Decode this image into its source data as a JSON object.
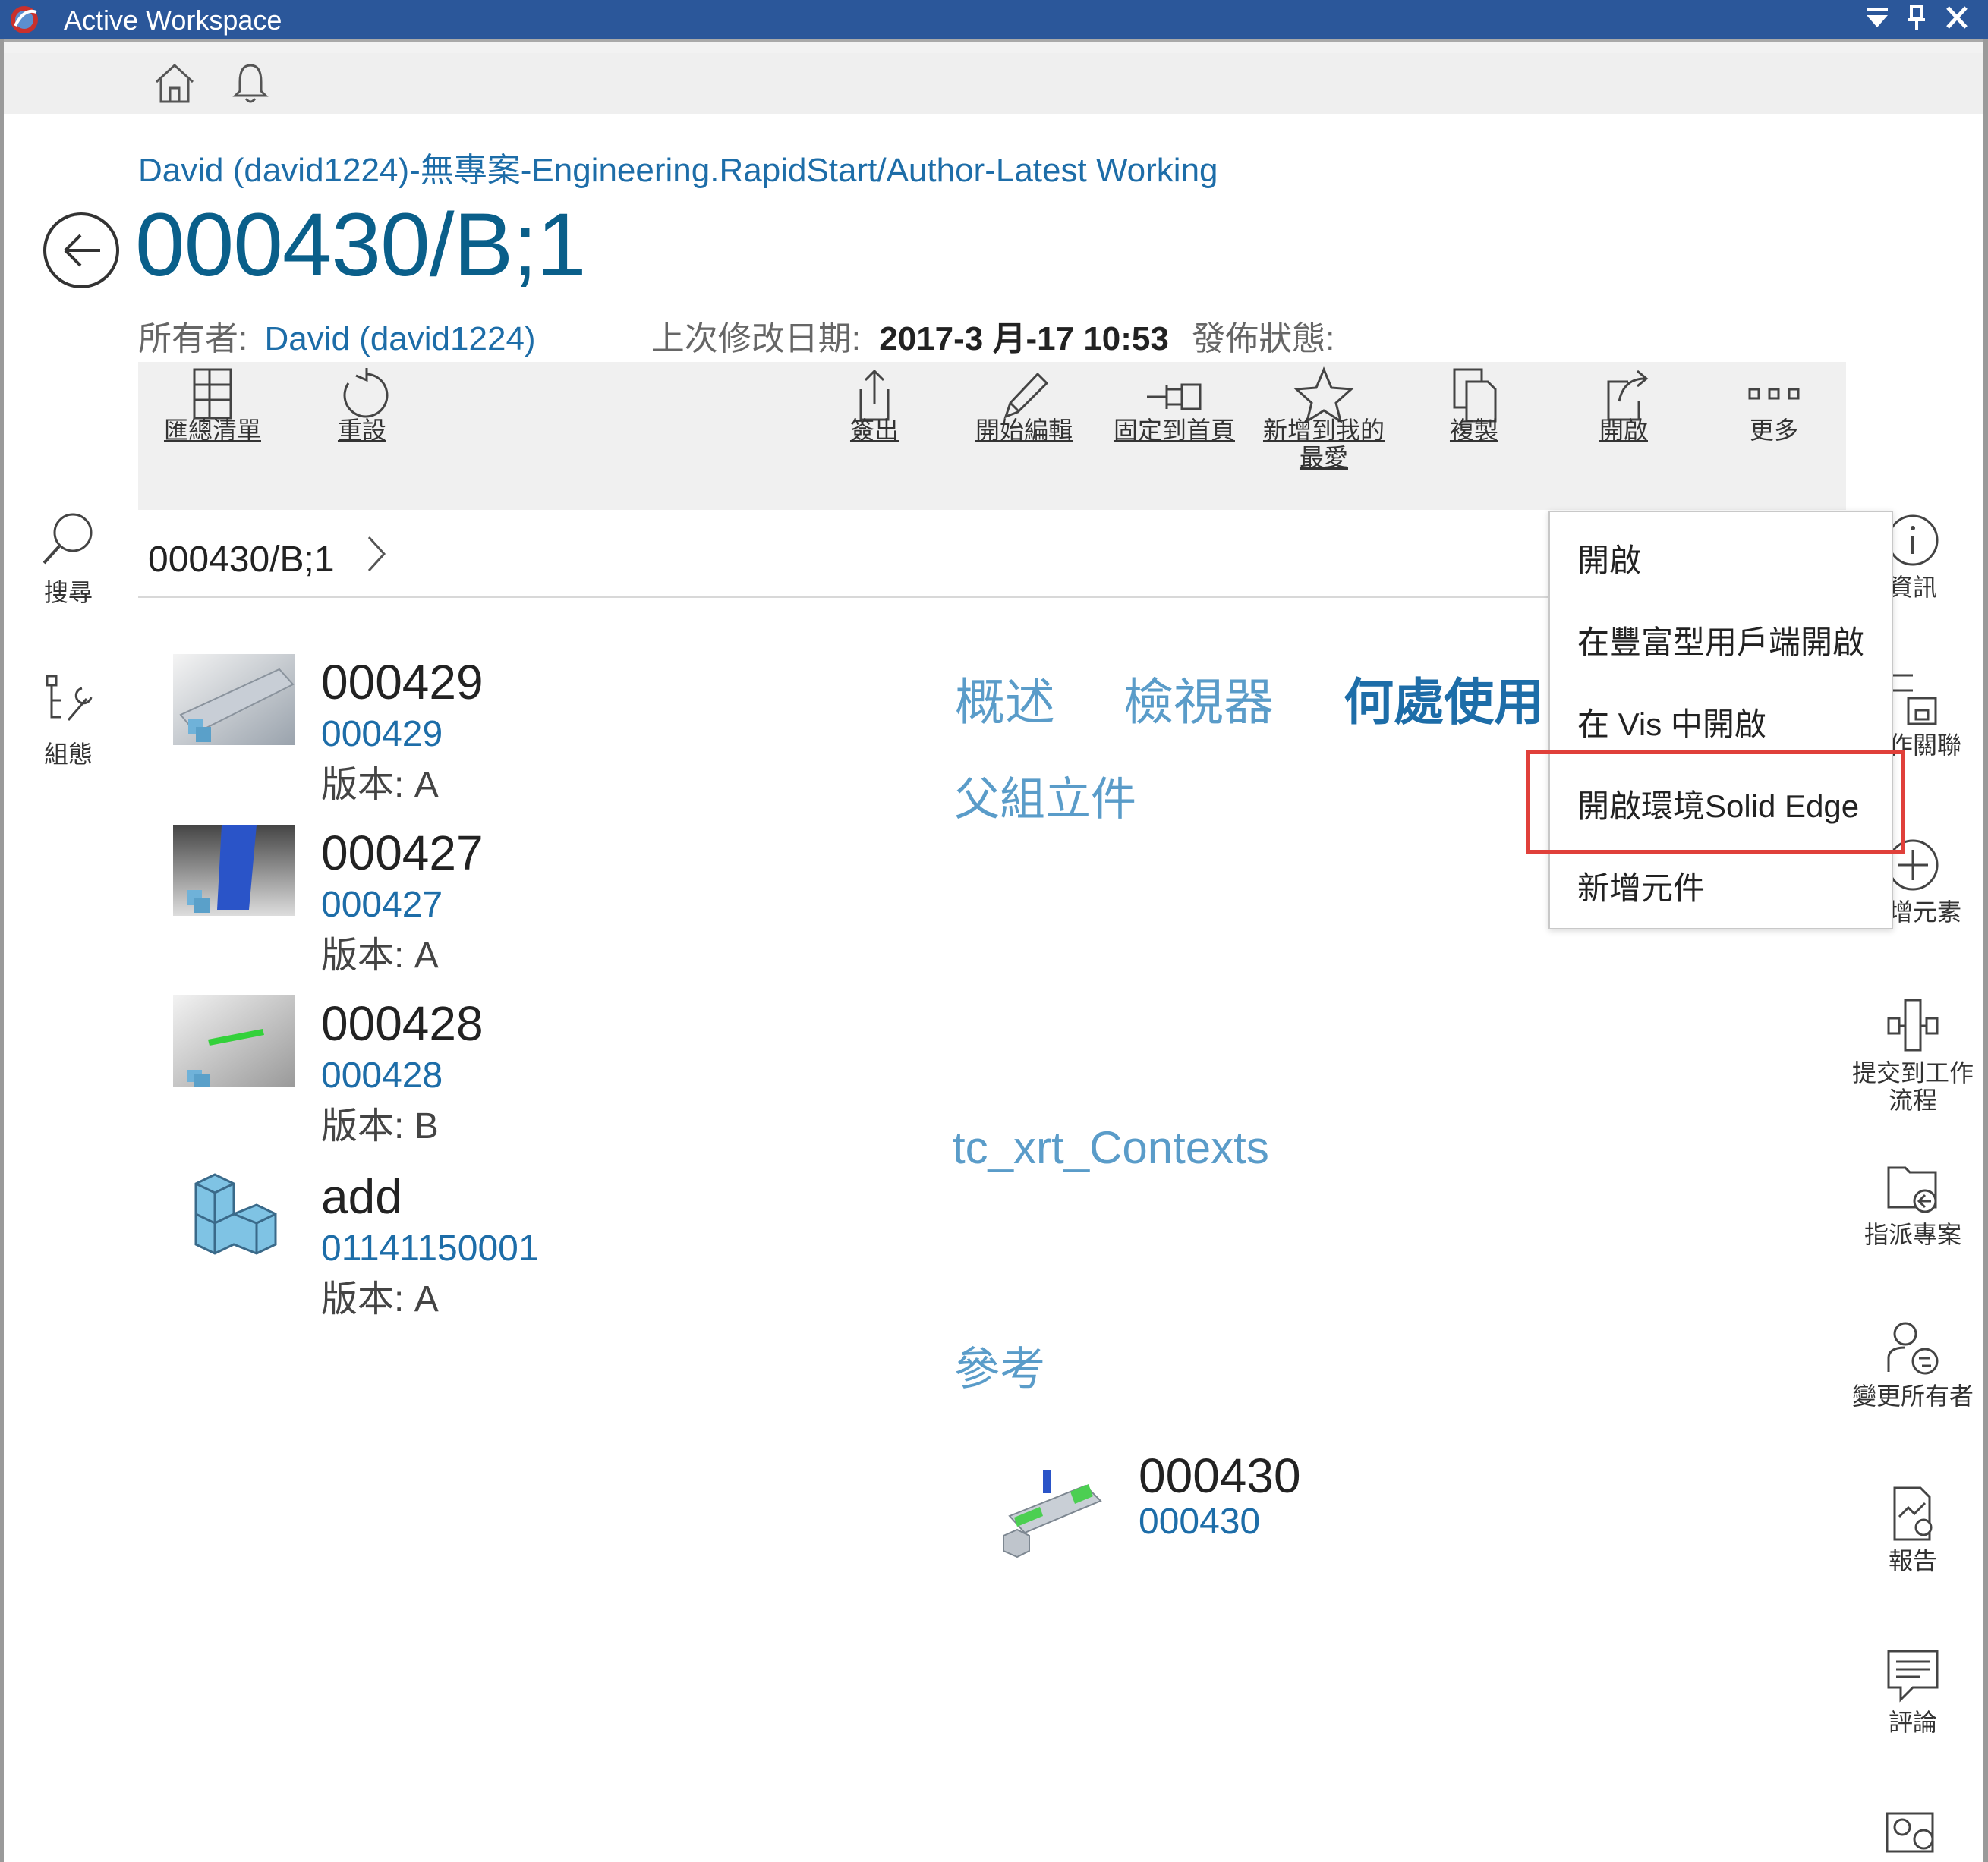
{
  "window": {
    "title": "Active Workspace",
    "controls": [
      "dropdown-icon",
      "pin-icon",
      "close-icon"
    ]
  },
  "topbar": {
    "icons": [
      "home-icon",
      "bell-icon"
    ]
  },
  "header": {
    "breadcrumb": "David (david1224)-無專案-Engineering.RapidStart/Author-Latest Working",
    "title": "000430/B;1",
    "owner_label": "所有者:",
    "owner_value": "David (david1224)",
    "modified_label": "上次修改日期:",
    "modified_value": "2017-3 月-17 10:53",
    "release_label": "發佈狀態:"
  },
  "toolbar": {
    "buttons": [
      {
        "label": "匯總清單",
        "icon": "summary-list-icon"
      },
      {
        "label": "重設",
        "icon": "reset-icon"
      },
      {
        "label": "簽出",
        "icon": "checkout-icon"
      },
      {
        "label": "開始編輯",
        "icon": "pencil-icon"
      },
      {
        "label": "固定到首頁",
        "icon": "pin-to-home-icon"
      },
      {
        "label": "新增到我的最愛",
        "icon": "star-icon"
      },
      {
        "label": "複製",
        "icon": "copy-icon"
      },
      {
        "label": "開啟",
        "icon": "open-icon"
      },
      {
        "label": "更多",
        "icon": "more-icon"
      }
    ]
  },
  "left_nav": [
    {
      "label": "搜尋",
      "icon": "search-icon"
    },
    {
      "label": "組態",
      "icon": "configuration-icon"
    }
  ],
  "location": {
    "crumb": "000430/B;1"
  },
  "list": [
    {
      "name": "000429",
      "id": "000429",
      "rev_label": "版本:",
      "rev": "A"
    },
    {
      "name": "000427",
      "id": "000427",
      "rev_label": "版本:",
      "rev": "A"
    },
    {
      "name": "000428",
      "id": "000428",
      "rev_label": "版本:",
      "rev": "B"
    },
    {
      "name": "add",
      "id": "01141150001",
      "rev_label": "版本:",
      "rev": "A"
    }
  ],
  "tabs": [
    "概述",
    "檢視器",
    "何處使用"
  ],
  "sections": {
    "parent_assemblies": "父組立件",
    "contexts": "tc_xrt_Contexts",
    "references": "參考"
  },
  "reference_item": {
    "name": "000430",
    "id": "000430"
  },
  "popup_menu": {
    "items": [
      "開啟",
      "在豐富型用戶端開啟",
      "在 Vis 中開啟",
      "開啟環境Solid Edge",
      "新增元件"
    ],
    "highlighted_index": 3
  },
  "right_rail": [
    {
      "label": "資訊",
      "icon": "info-icon"
    },
    {
      "label": "工作關聯",
      "icon": "work-context-icon"
    },
    {
      "label": "新增元素",
      "icon": "add-element-icon"
    },
    {
      "label": "提交到工作流程",
      "icon": "workflow-icon"
    },
    {
      "label": "指派專案",
      "icon": "assign-project-icon"
    },
    {
      "label": "變更所有者",
      "icon": "change-owner-icon"
    },
    {
      "label": "報告",
      "icon": "report-icon"
    },
    {
      "label": "評論",
      "icon": "comment-icon"
    },
    {
      "label": "",
      "icon": "ip-icon"
    }
  ],
  "colors": {
    "titlebar": "#2b579a",
    "link": "#1d6da8",
    "title": "#0a5f8a",
    "section": "#5a9cc9",
    "highlight": "#e0403a"
  }
}
